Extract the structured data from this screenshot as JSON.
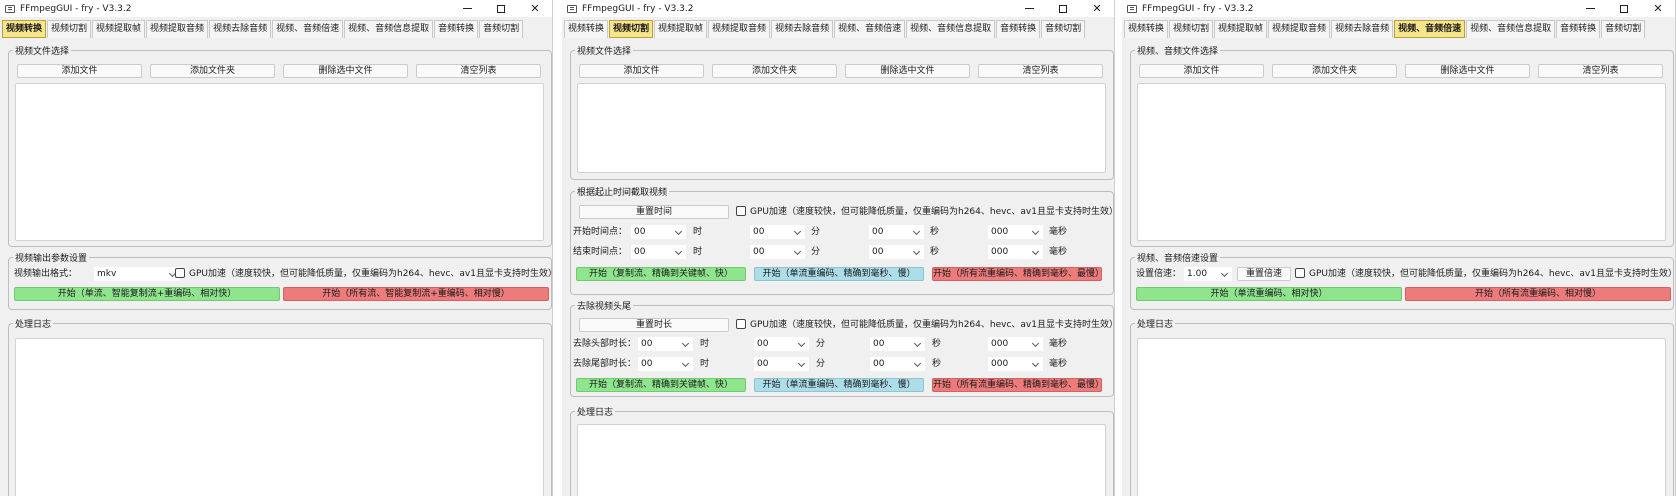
{
  "window_title": "FFmpegGUI - fry - V3.3.2",
  "tabs": [
    "视频转换",
    "视频切割",
    "视频提取帧",
    "视频提取音频",
    "视频去除音频",
    "视频、音频倍速",
    "视频、音频信息提取",
    "音频转换",
    "音频切割"
  ],
  "w1_active_tab": "视频转换",
  "w2_active_tab": "视频切割",
  "w3_active_tab": "视频、音频倍速",
  "file_buttons": {
    "add_file": "添加文件",
    "add_folder": "添加文件夹",
    "delete_selected": "删除选中文件",
    "clear_list": "清空列表"
  },
  "log_title": "处理日志",
  "gpu_text": "GPU加速（速度较快，但可能降低质量，仅重编码为h264、hevc、av1且显卡支持时生效）",
  "w1": {
    "file_group_title": "视频文件选择",
    "output_group_title": "视频输出参数设置",
    "format_label": "视频输出格式：",
    "format_value": "mkv",
    "start_fast": "开始（单流、智能复制流+重编码、相对快）",
    "start_slow": "开始（所有流、智能复制流+重编码、相对慢）"
  },
  "w2": {
    "file_group_title": "视频文件选择",
    "cut_group_title": "根据起止时间截取视频",
    "reset_time": "重置时间",
    "start_point": "开始时间点：",
    "end_point": "结束时间点：",
    "unit_h": "时",
    "unit_m": "分",
    "unit_s": "秒",
    "unit_ms": "毫秒",
    "v00": "00",
    "v000": "000",
    "start_copy": "开始（复制流、精确到关键帧、快）",
    "start_single": "开始（单流重编码、精确到毫秒、慢）",
    "start_all": "开始（所有流重编码、精确到毫秒、最慢）",
    "trim_group_title": "去除视频头尾",
    "reset_duration": "重置时长",
    "head_len": "去除头部时长：",
    "tail_len": "去除尾部时长："
  },
  "w3": {
    "file_group_title": "视频、音频文件选择",
    "speed_group_title": "视频、音频倍速设置",
    "speed_label": "设置倍速：",
    "speed_value": "1.00",
    "reset_speed": "重置倍速",
    "start_single": "开始（单流重编码、相对快）",
    "start_all": "开始（所有流重编码、相对慢）"
  },
  "colors": {
    "active_tab": "#f7e58b",
    "green_btn": "#8ee58e",
    "blue_btn": "#acdde9",
    "red_btn": "#ed7b7b"
  }
}
